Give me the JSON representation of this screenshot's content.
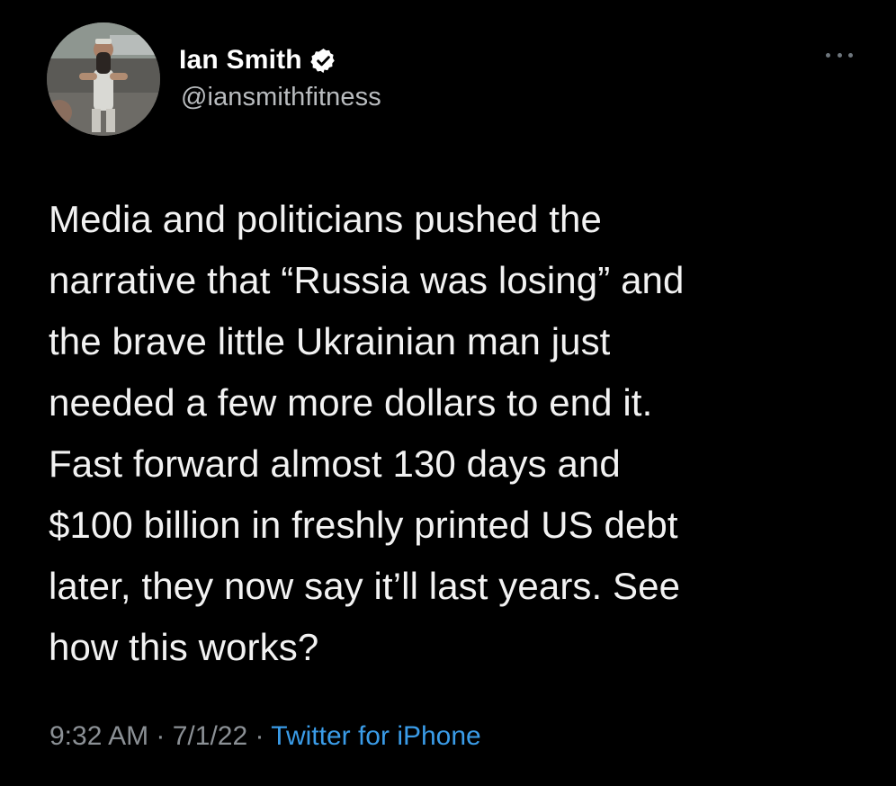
{
  "author": {
    "display_name": "Ian Smith",
    "handle": "@iansmithfitness",
    "verified": true
  },
  "tweet": {
    "text": "Media and politicians pushed the\nnarrative that “Russia was losing” and\nthe brave little Ukrainian man just\nneeded a few more dollars to end it.\nFast forward almost 130 days and\n$100 billion in freshly printed US debt\nlater, they now say it’ll last years. See\nhow this works?",
    "time": "9:32 AM",
    "separator": " · ",
    "date": "7/1/22",
    "source": "Twitter for iPhone"
  },
  "icons": {
    "verified": "verified-badge-icon",
    "more": "more-options-icon"
  },
  "colors": {
    "background": "#000000",
    "text": "#f2f2f2",
    "secondary": "#8b9095",
    "link": "#3a9ce8"
  }
}
